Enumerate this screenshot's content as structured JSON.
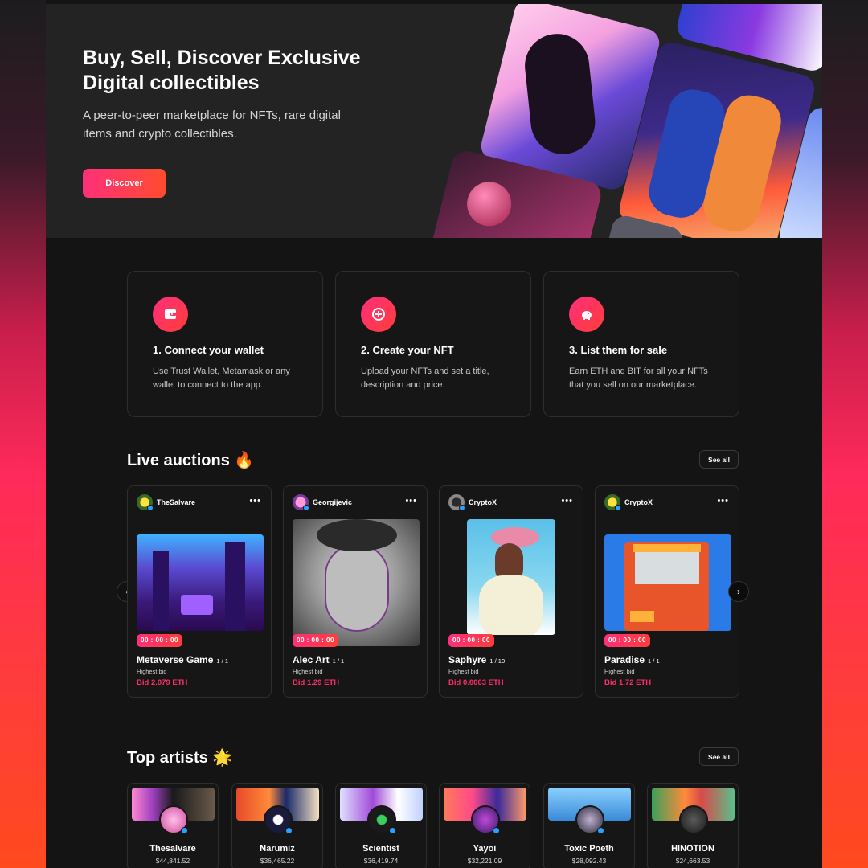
{
  "hero": {
    "title": "Buy, Sell, Discover Exclusive Digital collectibles",
    "subtitle": "A peer-to-peer marketplace for NFTs, rare digital items and crypto collectibles.",
    "cta": "Discover"
  },
  "steps": [
    {
      "icon": "wallet-icon",
      "title": "1. Connect your wallet",
      "desc": "Use Trust Wallet, Metamask or any wallet to connect to the app."
    },
    {
      "icon": "create-icon",
      "title": "2. Create your NFT",
      "desc": "Upload your NFTs and set a title, description and price."
    },
    {
      "icon": "piggy-bank-icon",
      "title": "3. List them for sale",
      "desc": "Earn ETH and BIT for all your NFTs that you sell on our marketplace."
    }
  ],
  "live_auctions": {
    "title": "Live auctions 🔥",
    "see_all": "See all",
    "cards": [
      {
        "owner": "TheSalvare",
        "timer": "00 : 00 : 00",
        "name": "Metaverse Game",
        "edition": "1 / 1",
        "bid_label": "Highest bid",
        "bid": "Bid 2.079 ETH"
      },
      {
        "owner": "Georgijevic",
        "timer": "00 : 00 : 00",
        "name": "Alec Art",
        "edition": "1 / 1",
        "bid_label": "Highest bid",
        "bid": "Bid 1.29 ETH"
      },
      {
        "owner": "CryptoX",
        "timer": "00 : 00 : 00",
        "name": "Saphyre",
        "edition": "1 / 10",
        "bid_label": "Highest bid",
        "bid": "Bid 0.0063 ETH"
      },
      {
        "owner": "CryptoX",
        "timer": "00 : 00 : 00",
        "name": "Paradise",
        "edition": "1 / 1",
        "bid_label": "Highest bid",
        "bid": "Bid 1.72 ETH"
      }
    ]
  },
  "top_artists": {
    "title": "Top artists 🌟",
    "see_all": "See all",
    "artists": [
      {
        "name": "Thesalvare",
        "value": "$44,841.52"
      },
      {
        "name": "Narumiz",
        "value": "$36,465.22"
      },
      {
        "name": "Scientist",
        "value": "$36,419.74"
      },
      {
        "name": "Yayoi",
        "value": "$32,221.09"
      },
      {
        "name": "Toxic Poeth",
        "value": "$28,092.43"
      },
      {
        "name": "HINOTION",
        "value": "$24,663.53"
      }
    ]
  },
  "colors": {
    "accent": "#ff2f7a",
    "accent2": "#ff3d3a",
    "bid": "#ff2f6a",
    "verified": "#2aa0ff"
  }
}
